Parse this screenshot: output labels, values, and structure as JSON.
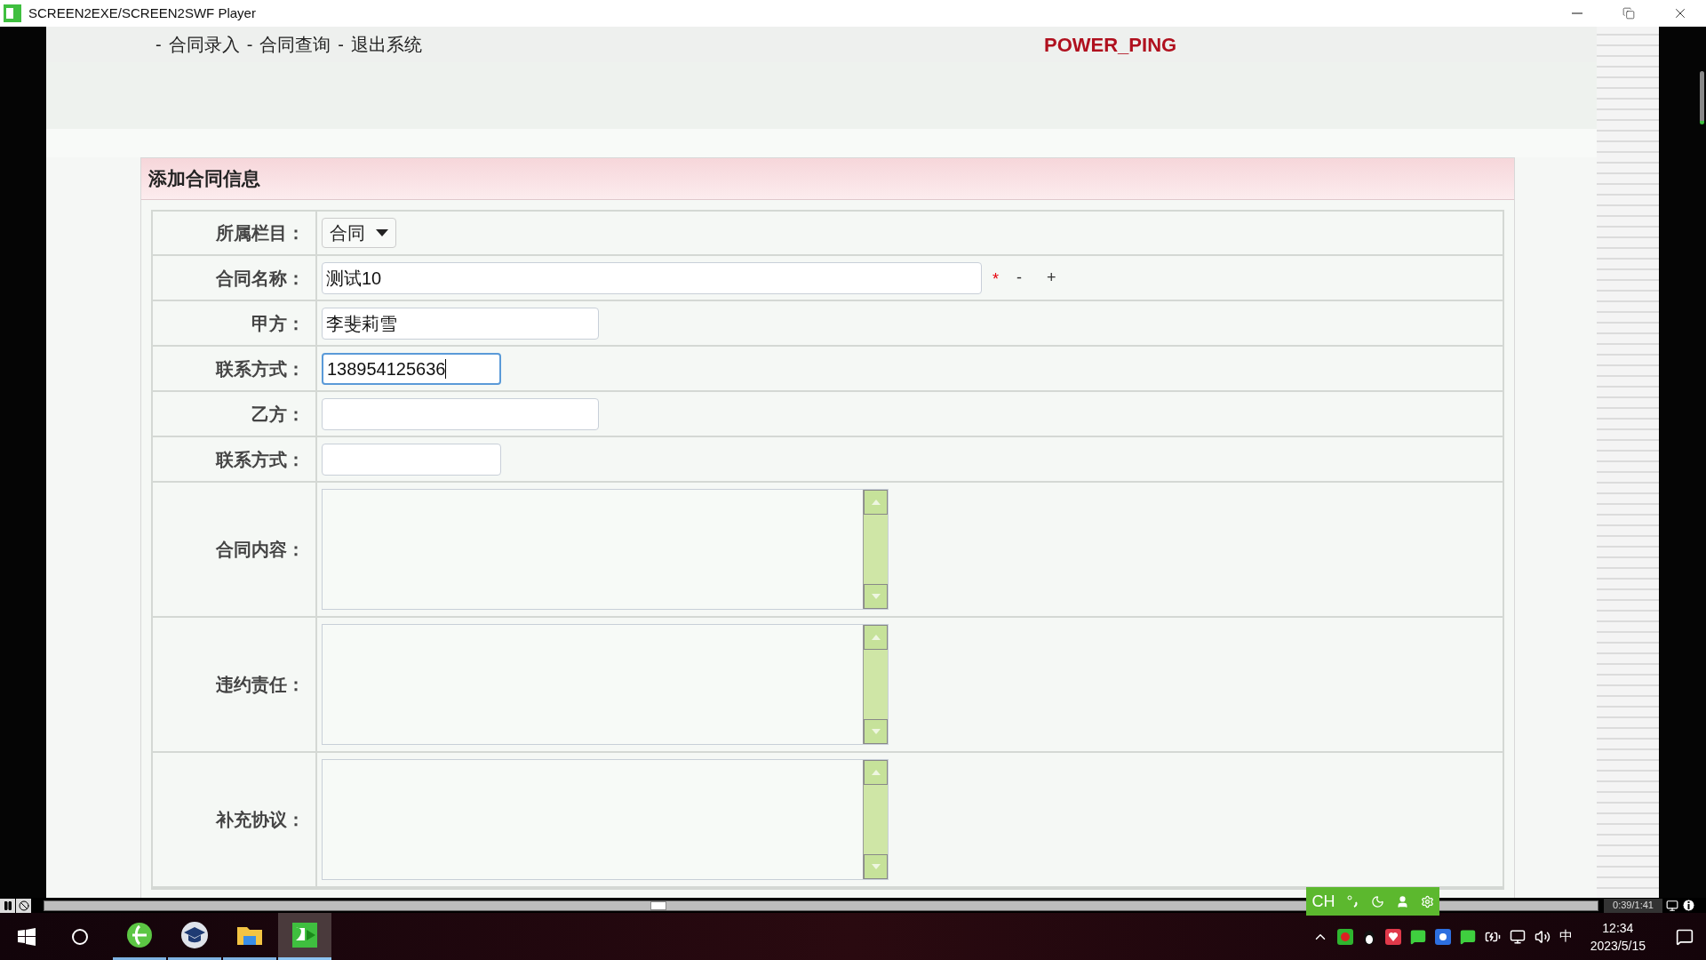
{
  "window": {
    "title": "SCREEN2EXE/SCREEN2SWF Player"
  },
  "nav": {
    "links": [
      {
        "prefix": "-",
        "text": "合同录入"
      },
      {
        "prefix": "-",
        "text": "合同查询"
      },
      {
        "prefix": "-",
        "text": "退出系统"
      }
    ],
    "brand": "POWER_PING"
  },
  "form": {
    "title": "添加合同信息",
    "rows": [
      {
        "label": "所属栏目：",
        "kind": "select",
        "value": "合同"
      },
      {
        "label": "合同名称：",
        "kind": "long_text",
        "value": "测试10",
        "focused": false,
        "required_mark": "*",
        "buttons": [
          "-",
          "+"
        ]
      },
      {
        "label": "甲方：",
        "kind": "medium_text",
        "value": "李斐莉雪",
        "focused": false
      },
      {
        "label": "联系方式：",
        "kind": "short_text",
        "value": "138954125636",
        "focused": true
      },
      {
        "label": "乙方：",
        "kind": "medium_text",
        "focused": false
      },
      {
        "label": "联系方式：",
        "kind": "short_text",
        "focused": false
      },
      {
        "label": "合同内容：",
        "kind": "textarea"
      },
      {
        "label": "违约责任：",
        "kind": "textarea"
      },
      {
        "label": "补充协议：",
        "kind": "textarea"
      }
    ]
  },
  "player": {
    "level": 0.39,
    "time": "0:39/1:41"
  },
  "ime": {
    "label": "CH"
  },
  "taskbar": {
    "apps": [
      {
        "kind": "browser",
        "active": false
      },
      {
        "kind": "school",
        "active": false
      },
      {
        "kind": "folder",
        "active": false
      },
      {
        "kind": "player",
        "active": true
      }
    ],
    "language": "中",
    "time": "12:34",
    "date": "2023/5/15"
  }
}
